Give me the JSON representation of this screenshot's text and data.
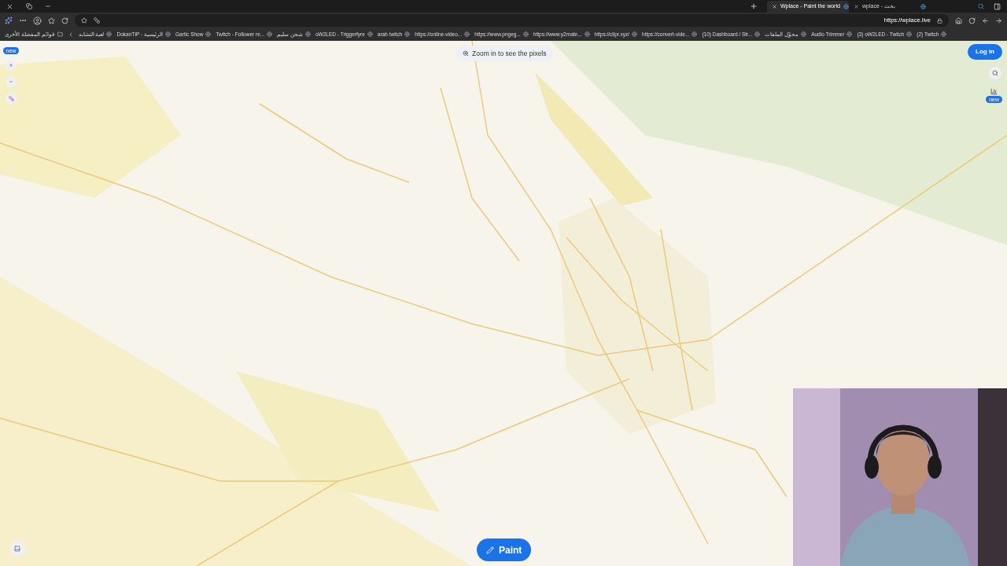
{
  "tabs": [
    {
      "title": "Wplace - Paint the world",
      "selected": true
    },
    {
      "title": "wplace - بحث",
      "selected": false
    }
  ],
  "address_bar": {
    "url": "https://wplace.live"
  },
  "other_favorites": "قوائم المفضلة الأخرى",
  "bookmarks": [
    {
      "label": "لعبة التشابه"
    },
    {
      "label": "DokanTIP - الرئيسية"
    },
    {
      "label": "Gartic Show"
    },
    {
      "label": "Twitch - Follower re..."
    },
    {
      "label": "شحن سليم"
    },
    {
      "label": "oW2LED - Triggerfyre"
    },
    {
      "label": "arab twitch"
    },
    {
      "label": "https://online-video..."
    },
    {
      "label": "https://www.pngeg..."
    },
    {
      "label": "https://www.y2mate..."
    },
    {
      "label": "https://clipr.xyz/"
    },
    {
      "label": "https://convert-vide..."
    },
    {
      "label": "(10) Dashboard / Str..."
    },
    {
      "label": "محوّل الملفات"
    },
    {
      "label": "Audio Trimmer"
    },
    {
      "label": "(3) oW2LED - Twitch"
    },
    {
      "label": "(2) Twitch"
    }
  ],
  "map": {
    "hint": "Zoom in to see the pixels",
    "left_badge": "new",
    "login": "Log in",
    "right_badge": "new",
    "paint": "Paint"
  }
}
